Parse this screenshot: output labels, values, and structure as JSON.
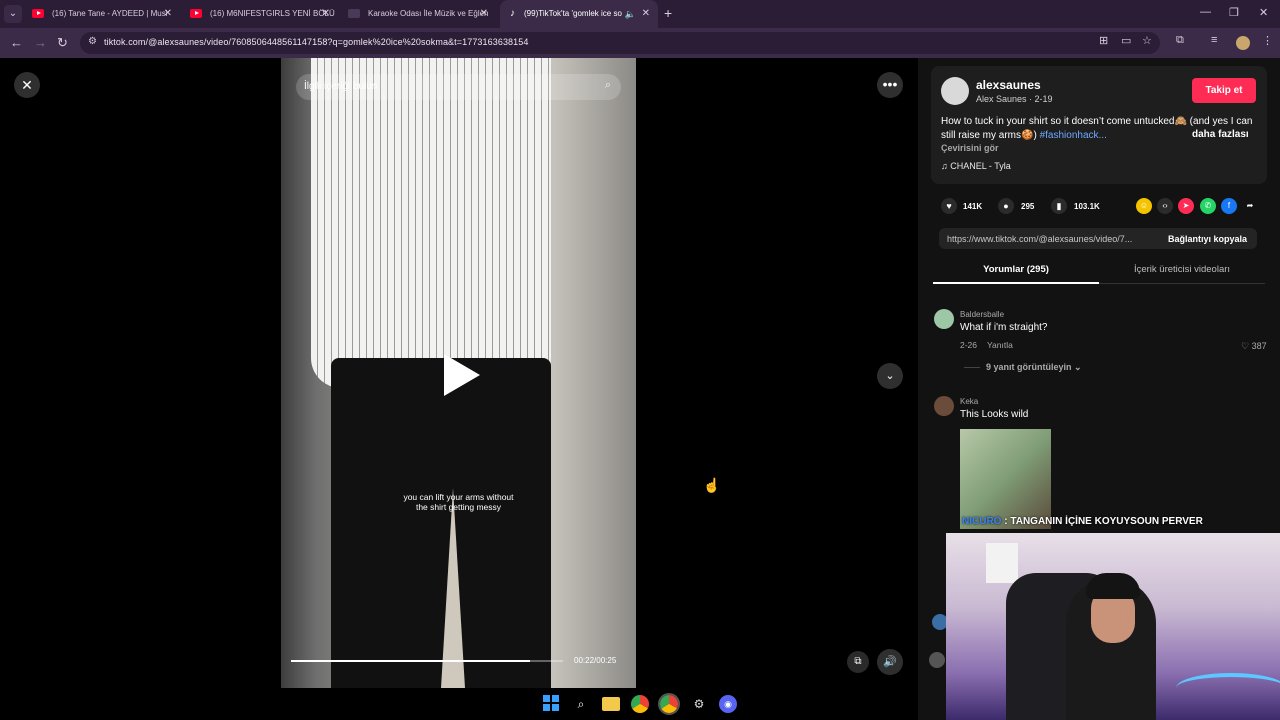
{
  "browser": {
    "tabs": [
      {
        "title": "(16) Tane Tane - AYDEED | Musi",
        "icon": "youtube-icon"
      },
      {
        "title": "(16) M6NIFESTGIRLS YENİ BÖLÜ",
        "icon": "youtube-icon"
      },
      {
        "title": "Karaoke Odası İle Müzik ve Eğlen",
        "icon": "site-icon"
      },
      {
        "title": "(99)TikTok'ta 'gomlek ice so",
        "icon": "tiktok-icon"
      }
    ],
    "url": "tiktok.com/@alexsaunes/video/7608506448561147158?q=gomlek%20ice%20sokma&t=1773163638154"
  },
  "video": {
    "search_placeholder": "İlgili içeriği bulun",
    "caption_line1": "you can lift your arms without",
    "caption_line2": "the shirt getting messy",
    "time": "00:22/00:25",
    "progress": 0.88
  },
  "author": {
    "username": "alexsaunes",
    "subline": "Alex Saunes · 2-19",
    "follow_label": "Takip et"
  },
  "post": {
    "desc_text": "How to tuck in your shirt so it doesn’t come untucked🙈 (and yes I can still raise my arms🍪) ",
    "desc_hashtag": "#fashionhack...",
    "more_label": "daha fazlası",
    "translate_label": "Çevirisini gör",
    "music": "♫  CHANEL - Tyla"
  },
  "stats": {
    "likes": "141K",
    "comments": "295",
    "saves": "103.1K"
  },
  "share": {
    "link": "https://www.tiktok.com/@alexsaunes/video/7...",
    "copy_label": "Bağlantıyı kopyala"
  },
  "tabs": {
    "comments": "Yorumlar (295)",
    "creator_videos": "İçerik üreticisi videoları"
  },
  "comments": [
    {
      "user": "Baldersballe",
      "text": "What if i'm straight?",
      "date": "2-26",
      "reply": "Yanıtla",
      "likes": "387",
      "view_replies": "9 yanıt görüntüleyin ⌄"
    },
    {
      "user": "Keka",
      "text": "This Looks wild"
    }
  ],
  "overlay_message": {
    "name": "NICURO",
    "text": "TANGANIN İÇİNE KOYUYSOUN PERVER"
  }
}
